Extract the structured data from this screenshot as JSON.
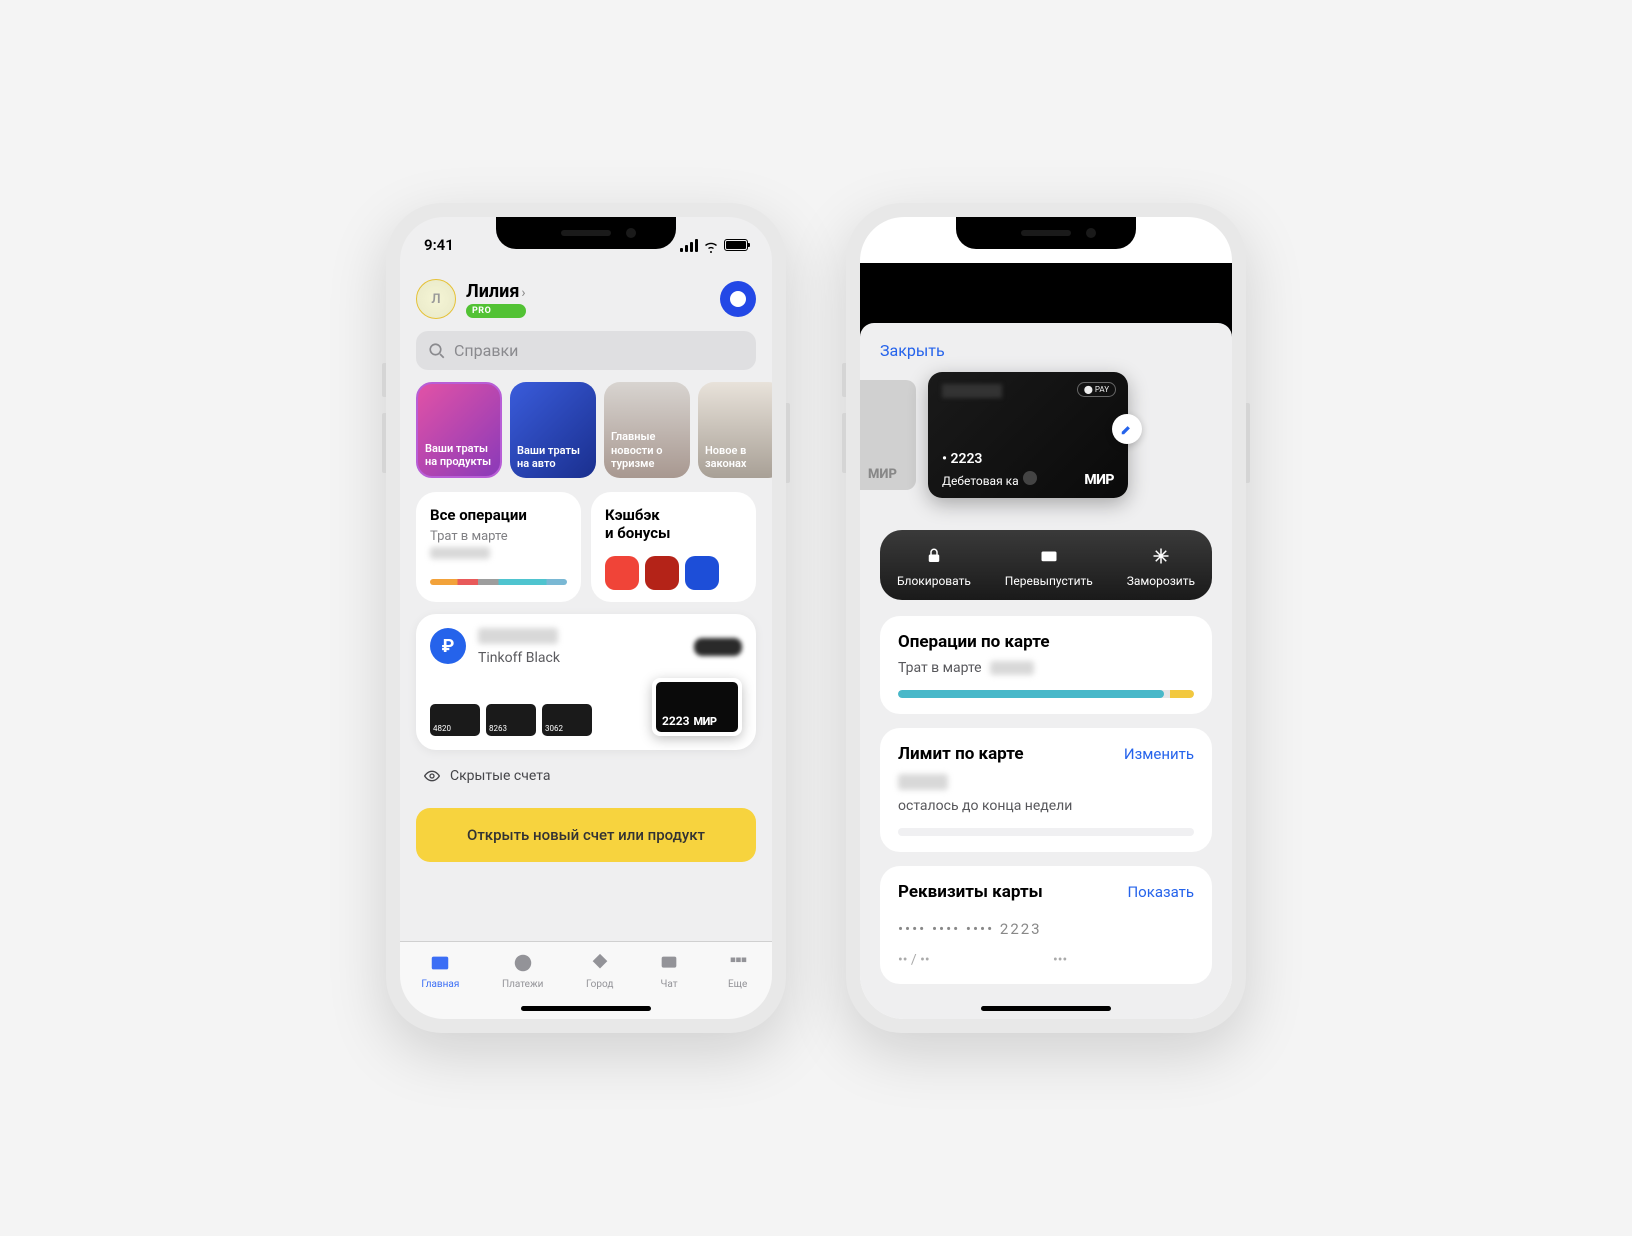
{
  "status": {
    "time": "9:41"
  },
  "left": {
    "user": {
      "initial": "Л",
      "name": "Лилия",
      "badge": "PRO"
    },
    "search": {
      "placeholder": "Справки"
    },
    "stories": [
      {
        "text": "Ваши траты на продукты"
      },
      {
        "text": "Ваши траты на авто"
      },
      {
        "text": "Главные новости о туризме"
      },
      {
        "text": "Новое в законах"
      }
    ],
    "widgets": {
      "ops": {
        "title": "Все операции",
        "sub": "Трат в марте"
      },
      "cashback": {
        "title": "Кэшбэк\nи бонусы"
      }
    },
    "account": {
      "name": "Tinkoff Black",
      "cards": [
        "4820",
        "8263",
        "3062"
      ],
      "featured": "2223",
      "mir": "МИР"
    },
    "hidden": "Скрытые счета",
    "open_button": "Открыть новый счет или продукт",
    "tabs": [
      "Главная",
      "Платежи",
      "Город",
      "Чат",
      "Еще"
    ]
  },
  "right": {
    "close": "Закрыть",
    "ghost_mir": "МИР",
    "card": {
      "last4": "• 2223",
      "type": "Дебетовая ка",
      "mir": "МИР",
      "pay": "PAY"
    },
    "actions": [
      "Блокировать",
      "Перевыпустить",
      "Заморозить"
    ],
    "ops": {
      "title": "Операции по карте",
      "sub": "Трат в марте"
    },
    "limit": {
      "title": "Лимит по карте",
      "link": "Изменить",
      "sub": "осталось до конца недели"
    },
    "details": {
      "title": "Реквизиты карты",
      "link": "Показать",
      "masked": "•••• •••• •••• 2223",
      "exp": "•• / ••",
      "cvv": "•••"
    }
  }
}
